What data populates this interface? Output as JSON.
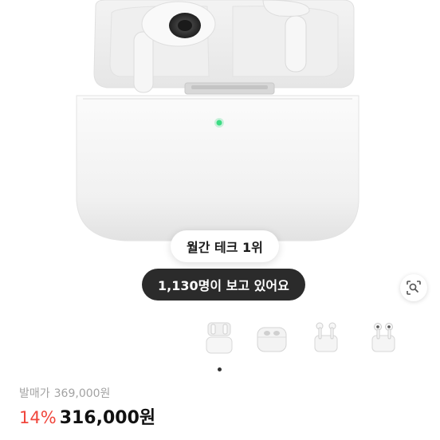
{
  "product": {
    "badges": {
      "rank": "월간 테크 1위",
      "watching": "1,130명이 보고 있어요"
    },
    "gallery": {
      "thumbnails": [
        {
          "name": "airpods-pro-2-thumb"
        },
        {
          "name": "airpods-3-thumb"
        },
        {
          "name": "airpods-pro-2-usbc-thumb"
        },
        {
          "name": "airpods-pro-thumb"
        }
      ],
      "active_index": 0
    },
    "price": {
      "list_label": "발매가",
      "list_price": "369,000원",
      "discount": "14%",
      "sale_price": "316,000원"
    },
    "colors": {
      "accent_discount": "#f0463c",
      "pill_dark": "#2b2b2b",
      "status_led": "#3ddc84"
    }
  }
}
